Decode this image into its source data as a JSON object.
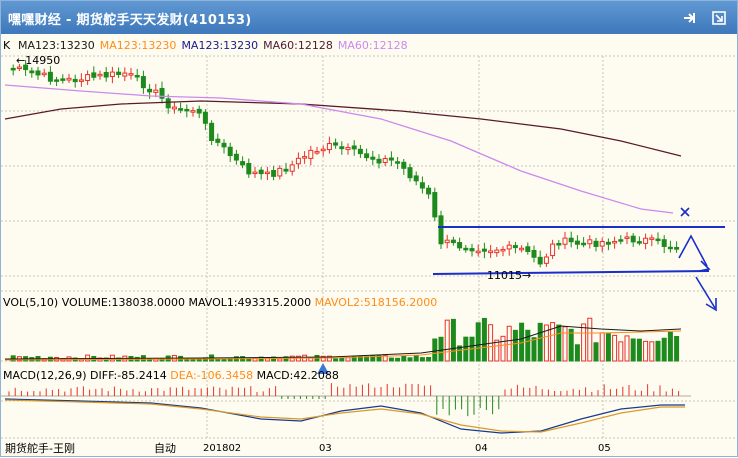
{
  "window": {
    "title": "嘿嘿财经 - 期货舵手天天发财(410153)"
  },
  "titlebar_icons": [
    "pin-icon",
    "maximize-icon"
  ],
  "kline": {
    "label_k": "K",
    "ma_parts": [
      {
        "text": "MA123:13230",
        "color": "#1a1a1a"
      },
      {
        "text": "MA123:13230",
        "color": "#ff8c1a"
      },
      {
        "text": "MA123:13230",
        "color": "#1a1a8c"
      },
      {
        "text": "MA60:12128",
        "color": "#4d1a33"
      },
      {
        "text": "MA60:12128",
        "color": "#cc88ee"
      }
    ],
    "annot_high": "←14950",
    "annot_low": "11015→"
  },
  "volume": {
    "label": "VOL(5,10)",
    "volume": "VOLUME:138038.0000",
    "mavol1": "MAVOL1:493315.2000",
    "mavol2": "MAVOL2:518156.2000",
    "mavol2_color": "#ff8c1a"
  },
  "macd": {
    "label": "MACD(12,26,9)",
    "diff": "DIFF:-85.2414",
    "dea": "DEA:-106.3458",
    "macd": "MACD:42.2088",
    "dea_color": "#ff8c1a"
  },
  "xaxis": {
    "left_text": "期货舵手-王刚",
    "auto_text": "自动",
    "ticks": [
      "201802",
      "03",
      "04",
      "05"
    ]
  },
  "colors": {
    "up": "#e8322b",
    "down": "#1c8a1c",
    "channel": "#1a2ecc",
    "ma_long": "#5a1a2e",
    "ma_mid": "#cc88ee",
    "grid": "#c9c6b8"
  }
}
